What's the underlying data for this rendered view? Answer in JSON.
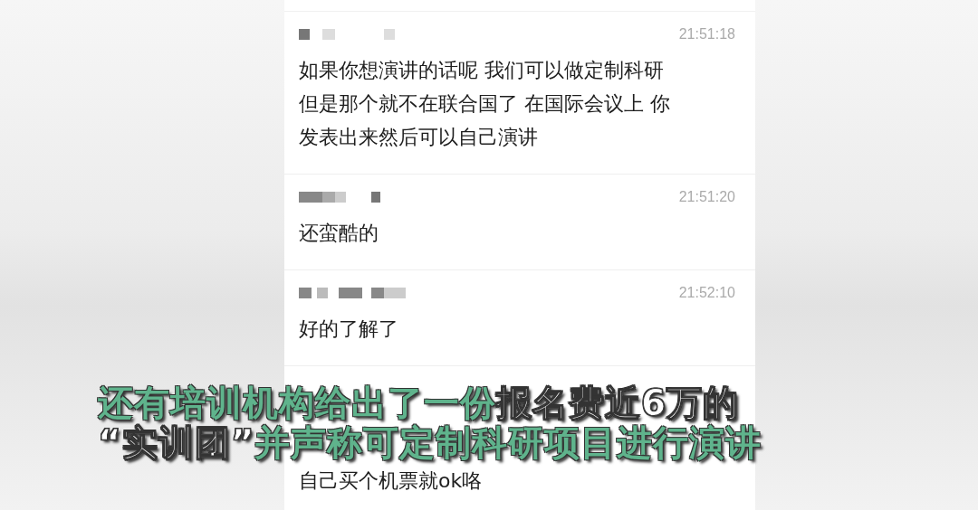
{
  "messages": [
    {
      "time": "21:51:18",
      "lines": [
        "如果你想演讲的话呢 我们可以做定制科研",
        "但是那个就不在联合国了 在国际会议上 你",
        "发表出来然后可以自己演讲"
      ]
    },
    {
      "time": "21:51:20",
      "lines": [
        "还蛮酷的"
      ]
    },
    {
      "time": "21:52:10",
      "lines": [
        "好的了解了"
      ]
    },
    {
      "lines": [
        "自己买个机票就ok咯"
      ]
    }
  ],
  "subtitles": [
    [
      {
        "text": "还有培训机构给出了一份",
        "highlight": true
      },
      {
        "text": "报名费近6万的",
        "highlight": false
      }
    ],
    [
      {
        "text": "“实训团”",
        "highlight": false
      },
      {
        "text": "并声称可定制科研项目进行演讲",
        "highlight": true
      }
    ]
  ]
}
